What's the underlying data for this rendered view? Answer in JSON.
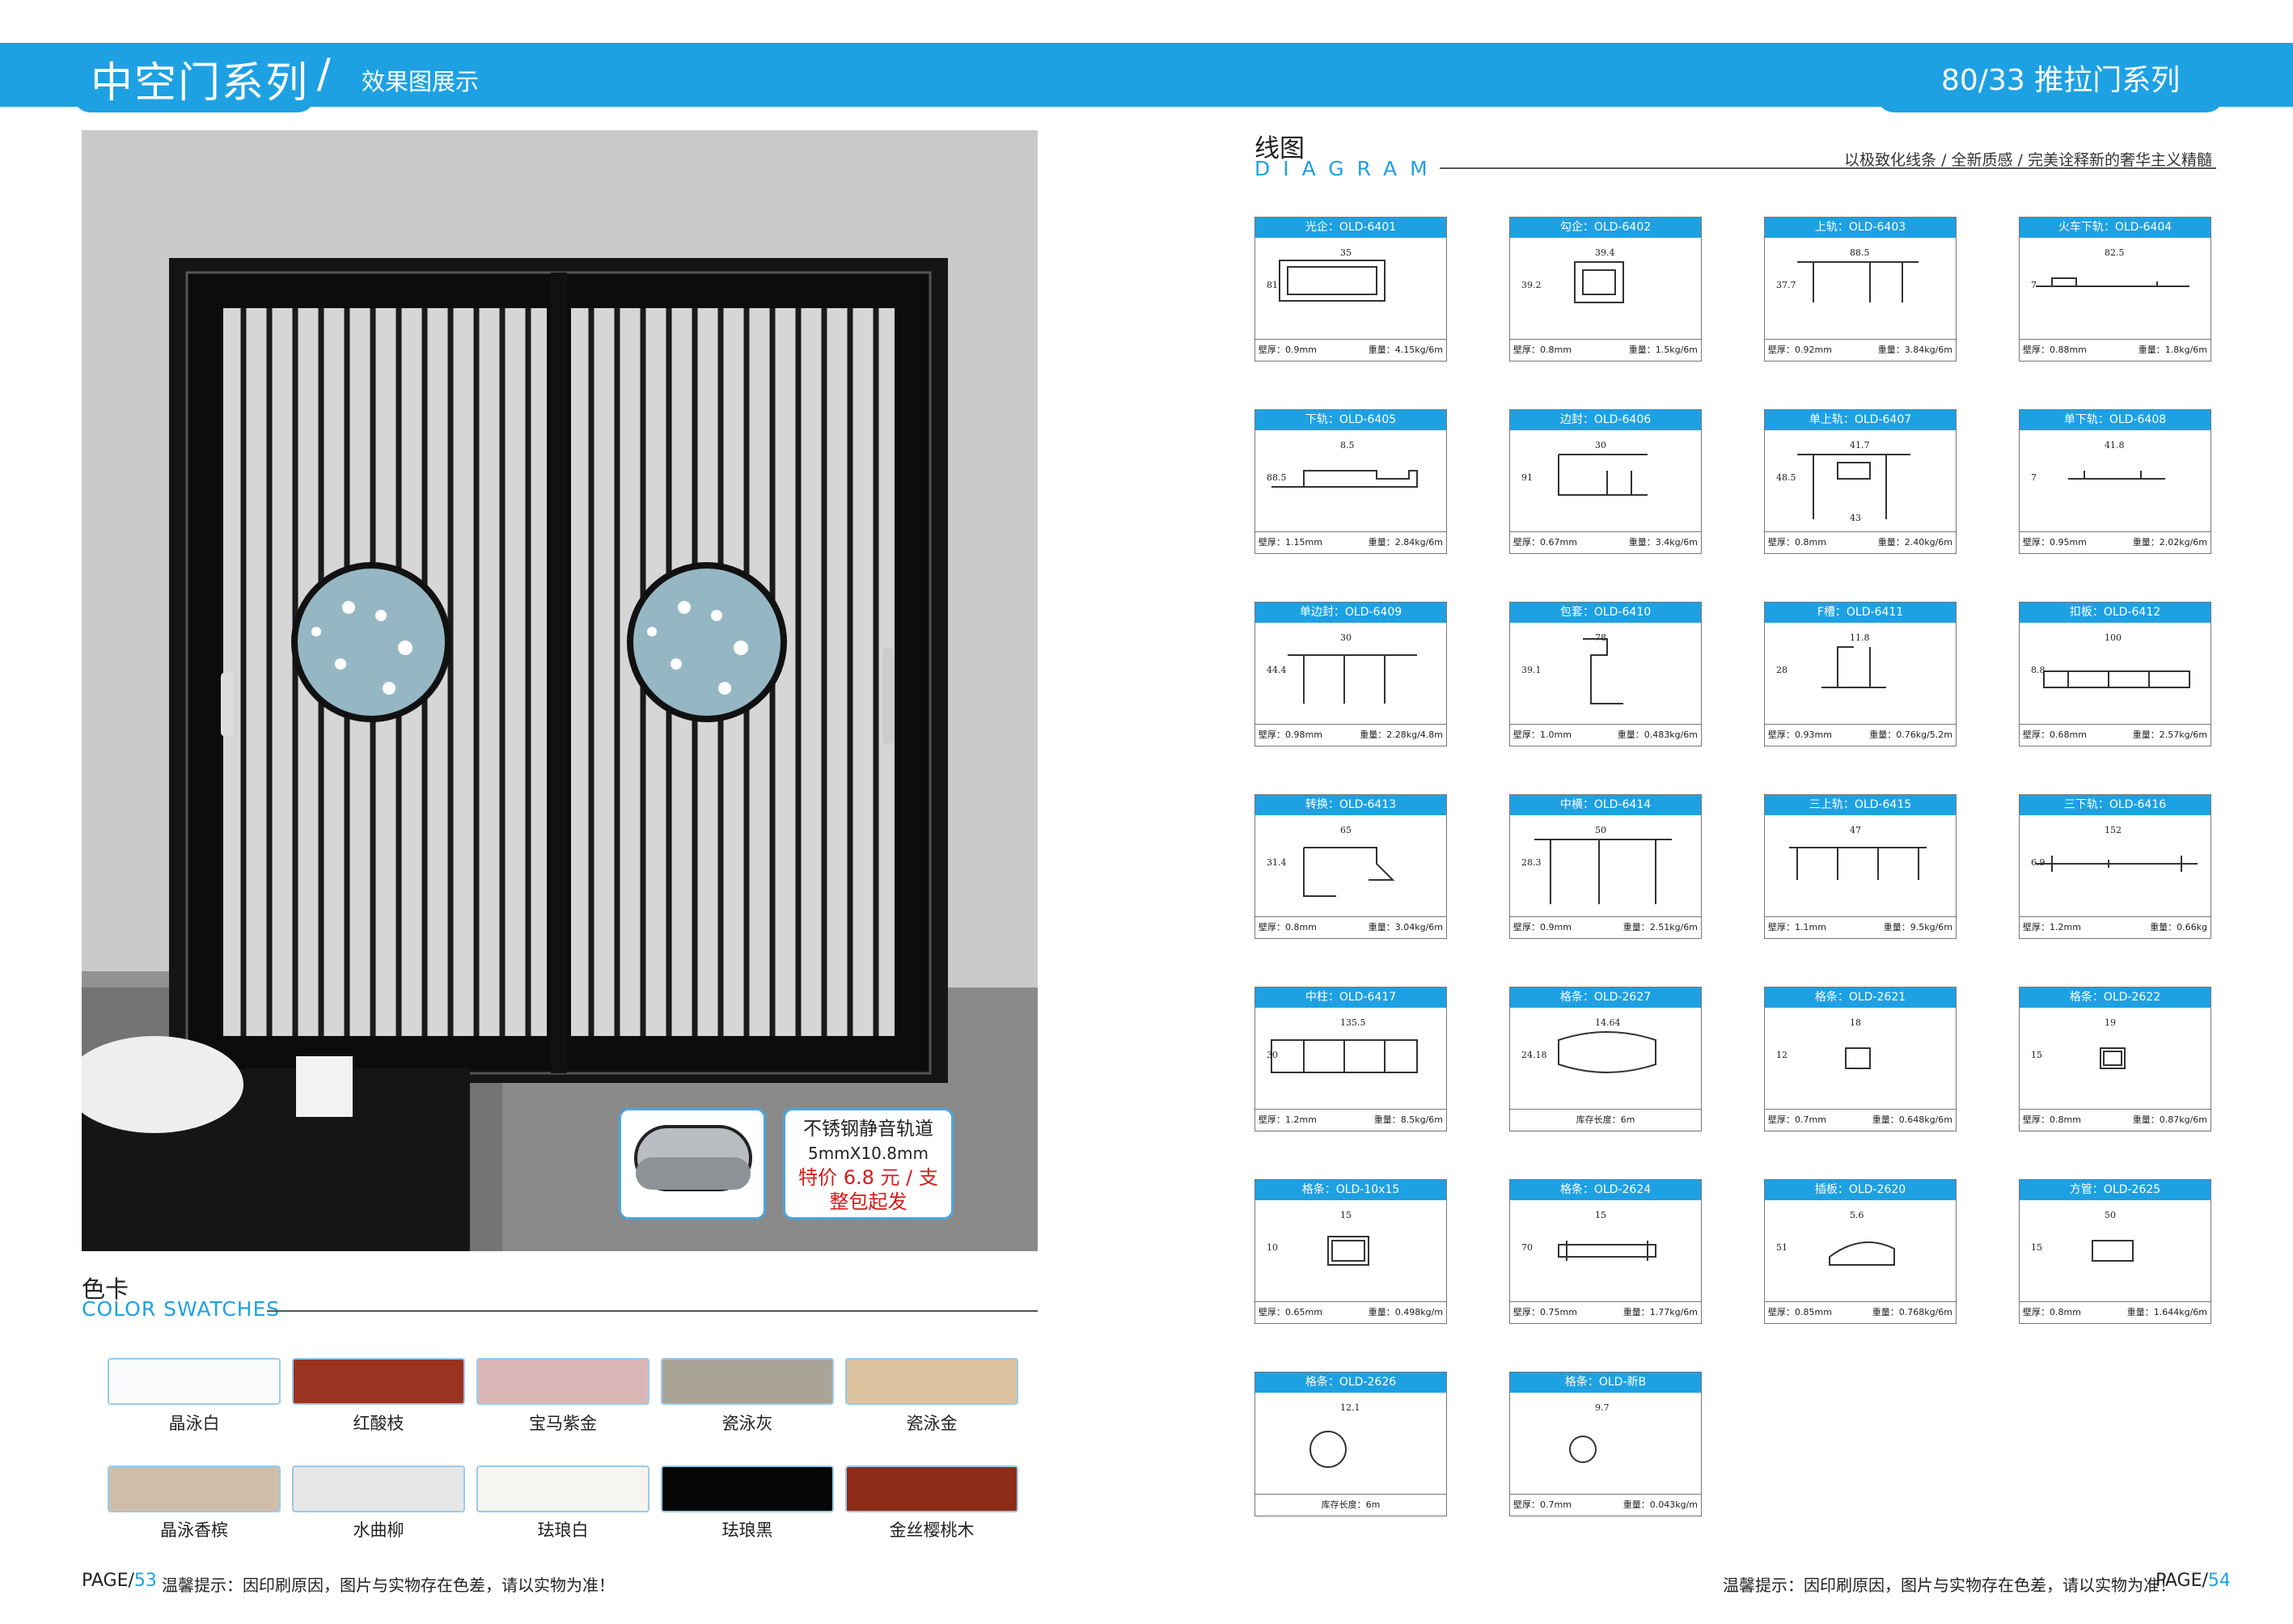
{
  "header": {
    "series_title": "中空门系列",
    "slash": "/",
    "subtitle": "效果图展示",
    "product_title": "80/33 推拉门系列"
  },
  "rail_callout": {
    "line1": "不锈钢静音轨道",
    "line2": "5mmX10.8mm",
    "line3": "特价 6.8 元 / 支",
    "line4": "整包起发"
  },
  "color_swatches": {
    "title": "色卡",
    "subtitle": "COLOR SWATCHES",
    "items": [
      {
        "name": "晶泳白",
        "color": "#f8fafc"
      },
      {
        "name": "红酸枝",
        "color": "#9a3420"
      },
      {
        "name": "宝马紫金",
        "color": "#dcb6b6"
      },
      {
        "name": "瓷泳灰",
        "color": "#aaa398"
      },
      {
        "name": "瓷泳金",
        "color": "#ddc3a0"
      },
      {
        "name": "晶泳香槟",
        "color": "#cfbfaa"
      },
      {
        "name": "水曲柳",
        "color": "#e6e6e6"
      },
      {
        "name": "珐琅白",
        "color": "#f7f5ef"
      },
      {
        "name": "珐琅黑",
        "color": "#050505"
      },
      {
        "name": "金丝樱桃木",
        "color": "#8e2b16"
      }
    ]
  },
  "diagram": {
    "title": "线图",
    "subtitle": "DIAGRAM",
    "slogan": "以极致化线条 / 全新质感 / 完美诠释新的奢华主义精髓",
    "cards": [
      {
        "title": "光企：OLD-6401",
        "left": "壁厚：0.9mm",
        "right": "重量：4.15kg/6m",
        "dims": [
          "35",
          "81"
        ]
      },
      {
        "title": "勾企：OLD-6402",
        "left": "壁厚：0.8mm",
        "right": "重量：1.5kg/6m",
        "dims": [
          "39.4",
          "39.2"
        ]
      },
      {
        "title": "上轨：OLD-6403",
        "left": "壁厚：0.92mm",
        "right": "重量：3.84kg/6m",
        "dims": [
          "88.5",
          "37.7"
        ]
      },
      {
        "title": "火车下轨：OLD-6404",
        "left": "壁厚：0.88mm",
        "right": "重量：1.8kg/6m",
        "dims": [
          "82.5",
          "7"
        ]
      },
      {
        "title": "下轨：OLD-6405",
        "left": "壁厚：1.15mm",
        "right": "重量：2.84kg/6m",
        "dims": [
          "8.5",
          "88.5"
        ]
      },
      {
        "title": "边封：OLD-6406",
        "left": "壁厚：0.67mm",
        "right": "重量：3.4kg/6m",
        "dims": [
          "30",
          "91"
        ]
      },
      {
        "title": "单上轨：OLD-6407",
        "left": "壁厚：0.8mm",
        "right": "重量：2.40kg/6m",
        "dims": [
          "41.7",
          "48.5",
          "43"
        ]
      },
      {
        "title": "单下轨：OLD-6408",
        "left": "壁厚：0.95mm",
        "right": "重量：2.02kg/6m",
        "dims": [
          "41.8",
          "7"
        ]
      },
      {
        "title": "单边封：OLD-6409",
        "left": "壁厚：0.98mm",
        "right": "重量：2.28kg/4.8m",
        "dims": [
          "30",
          "44.4"
        ]
      },
      {
        "title": "包套：OLD-6410",
        "left": "壁厚：1.0mm",
        "right": "重量：0.483kg/6m",
        "dims": [
          "78",
          "39.1"
        ]
      },
      {
        "title": "F槽：OLD-6411",
        "left": "壁厚：0.93mm",
        "right": "重量：0.76kg/5.2m",
        "dims": [
          "11.8",
          "28"
        ]
      },
      {
        "title": "扣板：OLD-6412",
        "left": "壁厚：0.68mm",
        "right": "重量：2.57kg/6m",
        "dims": [
          "100",
          "8.8"
        ]
      },
      {
        "title": "转换：OLD-6413",
        "left": "壁厚：0.8mm",
        "right": "重量：3.04kg/6m",
        "dims": [
          "65",
          "31.4"
        ]
      },
      {
        "title": "中横：OLD-6414",
        "left": "壁厚：0.9mm",
        "right": "重量：2.51kg/6m",
        "dims": [
          "50",
          "28.3"
        ]
      },
      {
        "title": "三上轨：OLD-6415",
        "left": "壁厚：1.1mm",
        "right": "重量：9.5kg/6m",
        "dims": [
          "47"
        ]
      },
      {
        "title": "三下轨：OLD-6416",
        "left": "壁厚：1.2mm",
        "right": "重量：0.66kg",
        "dims": [
          "152",
          "6.9"
        ]
      },
      {
        "title": "中柱：OLD-6417",
        "left": "壁厚：1.2mm",
        "right": "重量：8.5kg/6m",
        "dims": [
          "135.5",
          "30"
        ]
      },
      {
        "title": "格条：OLD-2627",
        "left": "库存长度：6m",
        "right": "",
        "dims": [
          "14.64",
          "24.18"
        ]
      },
      {
        "title": "格条：OLD-2621",
        "left": "壁厚：0.7mm",
        "right": "重量：0.648kg/6m",
        "dims": [
          "18",
          "12"
        ]
      },
      {
        "title": "格条：OLD-2622",
        "left": "壁厚：0.8mm",
        "right": "重量：0.87kg/6m",
        "dims": [
          "19",
          "15"
        ]
      },
      {
        "title": "格条：OLD-10x15",
        "left": "壁厚：0.65mm",
        "right": "重量：0.498kg/m",
        "dims": [
          "15",
          "10"
        ]
      },
      {
        "title": "格条：OLD-2624",
        "left": "壁厚：0.75mm",
        "right": "重量：1.77kg/6m",
        "dims": [
          "15",
          "70"
        ]
      },
      {
        "title": "插板：OLD-2620",
        "left": "壁厚：0.85mm",
        "right": "重量：0.768kg/6m",
        "dims": [
          "5.6",
          "51"
        ]
      },
      {
        "title": "方管：OLD-2625",
        "left": "壁厚：0.8mm",
        "right": "重量：1.644kg/6m",
        "dims": [
          "50",
          "15"
        ]
      },
      {
        "title": "格条：OLD-2626",
        "left": "库存长度：6m",
        "right": "",
        "dims": [
          "12.1"
        ]
      },
      {
        "title": "格条：OLD-新B",
        "left": "壁厚：0.7mm",
        "right": "重量：0.043kg/m",
        "dims": [
          "9.7"
        ]
      }
    ]
  },
  "footer": {
    "page_left_prefix": "PAGE/",
    "page_left_num": "53",
    "notice_left": "温馨提示：因印刷原因，图片与实物存在色差，请以实物为准！",
    "notice_right": "温馨提示：因印刷原因，图片与实物存在色差，请以实物为准！",
    "page_right_prefix": "PAGE/",
    "page_right_num": "54"
  }
}
